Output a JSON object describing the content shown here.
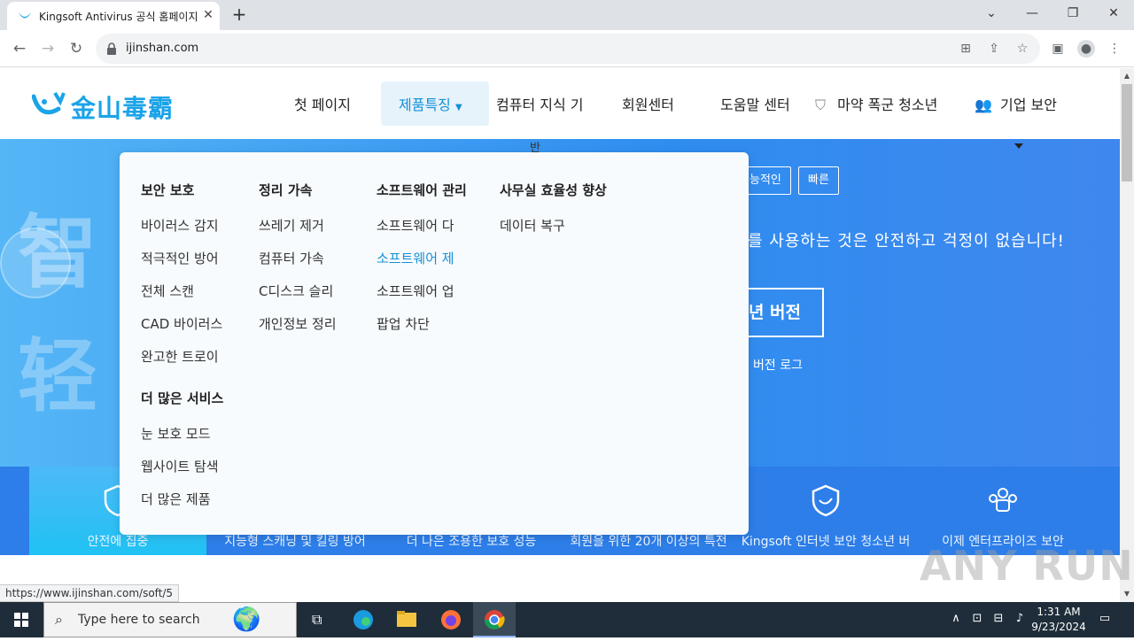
{
  "browser": {
    "tab_title": "Kingsoft Antivirus 공식 홈페이지",
    "tab_close": "✕",
    "new_tab": "+",
    "url": "ijinshan.com",
    "status_url": "https://www.ijinshan.com/soft/5"
  },
  "site": {
    "logo_text": "金山毒霸",
    "nav": [
      {
        "label": "첫 페이지"
      },
      {
        "label": "제품특징"
      },
      {
        "label": "컴퓨터 지식 기"
      },
      {
        "label": "회원센터"
      },
      {
        "label": "도움말 센터"
      },
      {
        "label": "마약 폭군 청소년"
      },
      {
        "label": "기업 보안"
      }
    ],
    "nav_overflow": "반"
  },
  "hero": {
    "big_char_1": "智",
    "big_char_2": "轻",
    "tags": [
      "능적인",
      "빠른"
    ],
    "text": "를 사용하는 것은 안전하고 걱정이 없습니다!",
    "button": "년 버전",
    "log_link": "버전 로그"
  },
  "features": [
    {
      "label": "안전에 집중"
    },
    {
      "label": "지능형 스캐닝 및 킬링 방어"
    },
    {
      "label": "더 나은 조용한 보호 성능"
    },
    {
      "label": "회원을 위한 20개 이상의 특전"
    },
    {
      "label": "Kingsoft 인터넷 보안 청소년 버"
    },
    {
      "label": "이제 엔터프라이즈 보안"
    }
  ],
  "dropdown": {
    "col1_head": "보안 보호",
    "col1_items": [
      "바이러스 감지",
      "적극적인 방어",
      "전체 스캔",
      "CAD 바이러스",
      "완고한 트로이"
    ],
    "col1_head2": "더 많은 서비스",
    "col1_items2": [
      "눈 보호 모드",
      "웹사이트 탐색",
      "더 많은 제품"
    ],
    "col2_head": "정리 가속",
    "col2_items": [
      "쓰레기 제거",
      "컴퓨터 가속",
      "C디스크 슬리",
      "개인정보 정리"
    ],
    "col3_head": "소프트웨어 관리",
    "col3_items": [
      "소프트웨어 다",
      "소프트웨어 제",
      "소프트웨어 업",
      "팝업 차단"
    ],
    "col4_head": "사무실 효율성 향상",
    "col4_items": [
      "데이터 복구"
    ]
  },
  "watermark": "ANY RUN",
  "taskbar": {
    "search_placeholder": "Type here to search",
    "time": "1:31 AM",
    "date": "9/23/2024"
  },
  "colors": {
    "accent": "#1590d6",
    "hero": "#2f8df0",
    "taskbar": "#1f2d3a"
  }
}
